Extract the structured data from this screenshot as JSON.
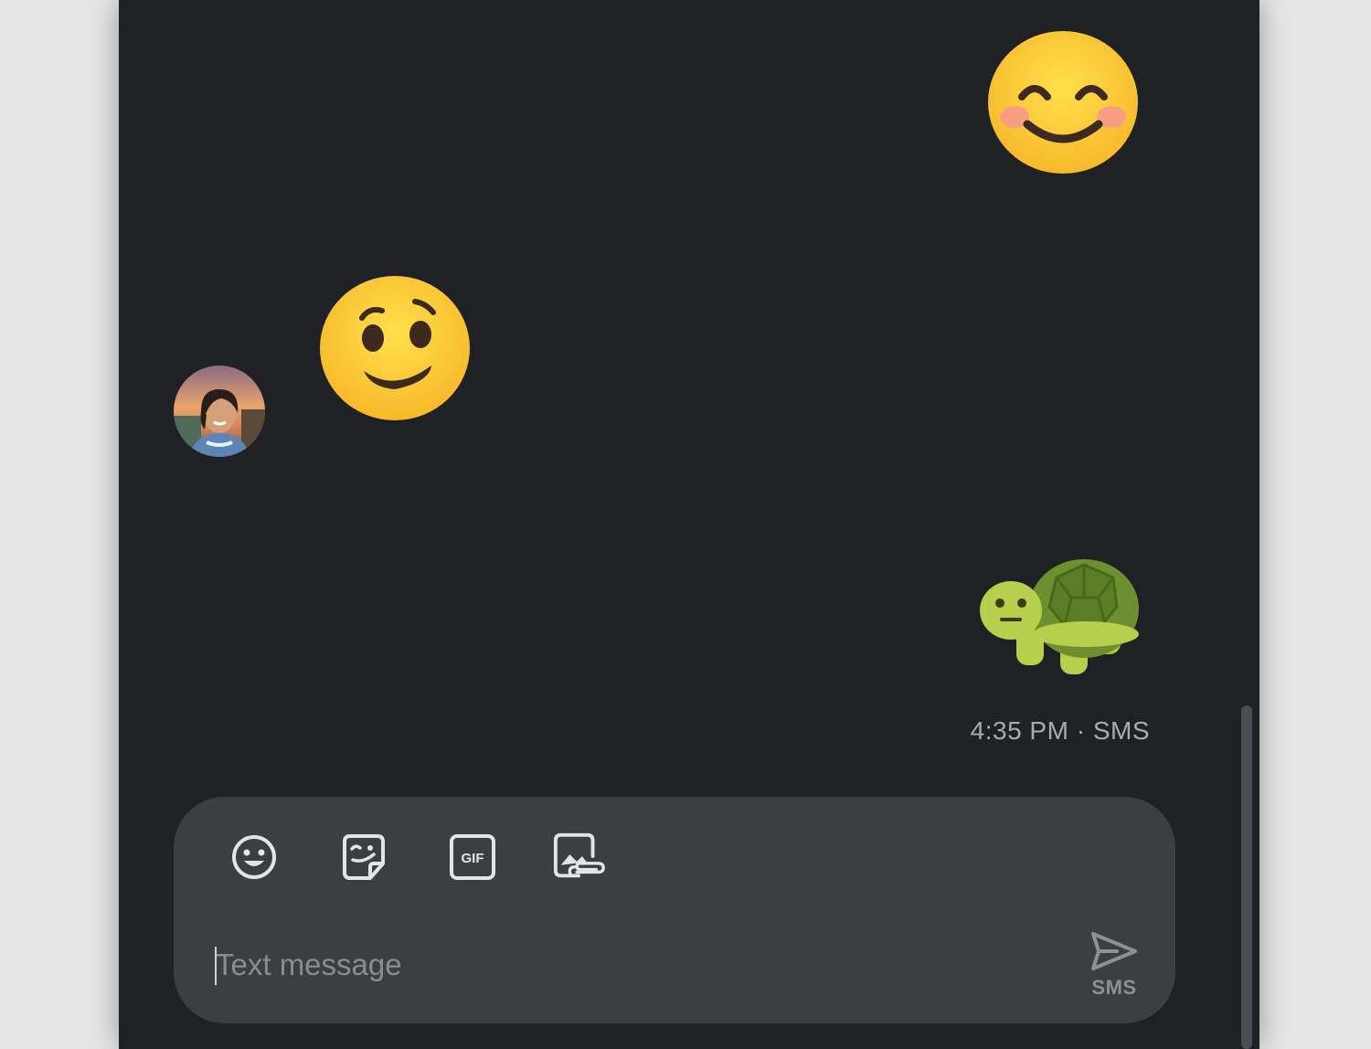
{
  "messages": [
    {
      "direction": "outgoing",
      "emoji": "smiling-face-with-smiling-eyes"
    },
    {
      "direction": "incoming",
      "emoji": "woozy-face",
      "sender_avatar": "avatar"
    },
    {
      "direction": "outgoing",
      "emoji": "turtle"
    }
  ],
  "last_message_meta": "4:35 PM · SMS",
  "compose": {
    "placeholder": "Text message",
    "tools": [
      "emoji-icon",
      "sticker-icon",
      "gif-icon",
      "attach-media-icon"
    ],
    "send_label": "SMS"
  },
  "colors": {
    "background": "#202124",
    "compose_bg": "#3b3e42",
    "muted_text": "#a9abae",
    "emoji_yellow": "#fcd34d",
    "turtle_green": "#b7cf4c"
  }
}
